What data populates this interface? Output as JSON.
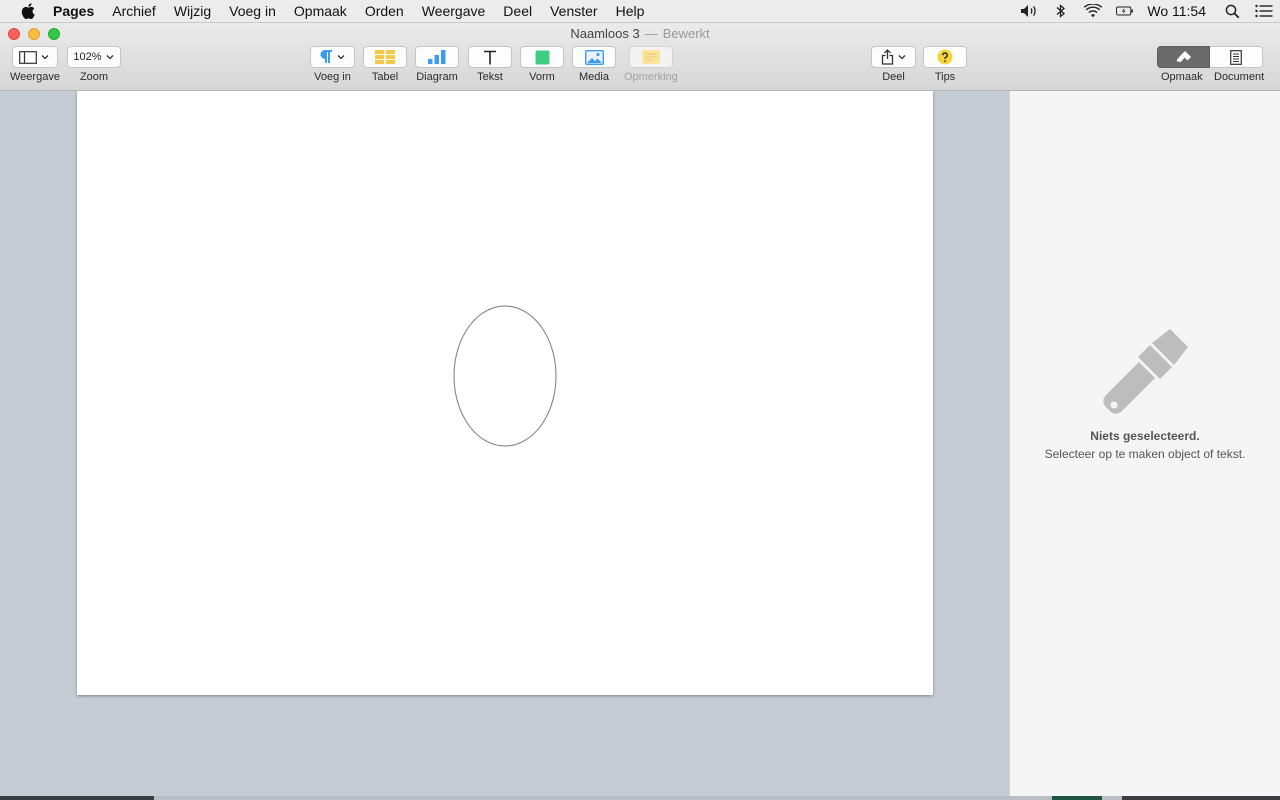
{
  "menubar": {
    "app_name": "Pages",
    "items": [
      "Archief",
      "Wijzig",
      "Voeg in",
      "Opmaak",
      "Orden",
      "Weergave",
      "Deel",
      "Venster",
      "Help"
    ],
    "clock": "Wo 11:54"
  },
  "window": {
    "title": "Naamloos 3",
    "separator": "—",
    "status": "Bewerkt"
  },
  "toolbar": {
    "view_label": "Weergave",
    "zoom_value": "102%",
    "zoom_label": "Zoom",
    "insert_label": "Voeg in",
    "table_label": "Tabel",
    "chart_label": "Diagram",
    "text_label": "Tekst",
    "shape_label": "Vorm",
    "media_label": "Media",
    "comment_label": "Opmerking",
    "share_label": "Deel",
    "tips_label": "Tips",
    "format_label": "Opmaak",
    "document_label": "Document"
  },
  "inspector": {
    "empty_title": "Niets geselecteerd.",
    "empty_subtitle": "Selecteer op te maken object of tekst."
  },
  "colors": {
    "accent_blue": "#3d9cf0",
    "table_yellow": "#f7c948",
    "shape_green": "#3ccf82",
    "tips_yellow": "#f7d33a"
  }
}
